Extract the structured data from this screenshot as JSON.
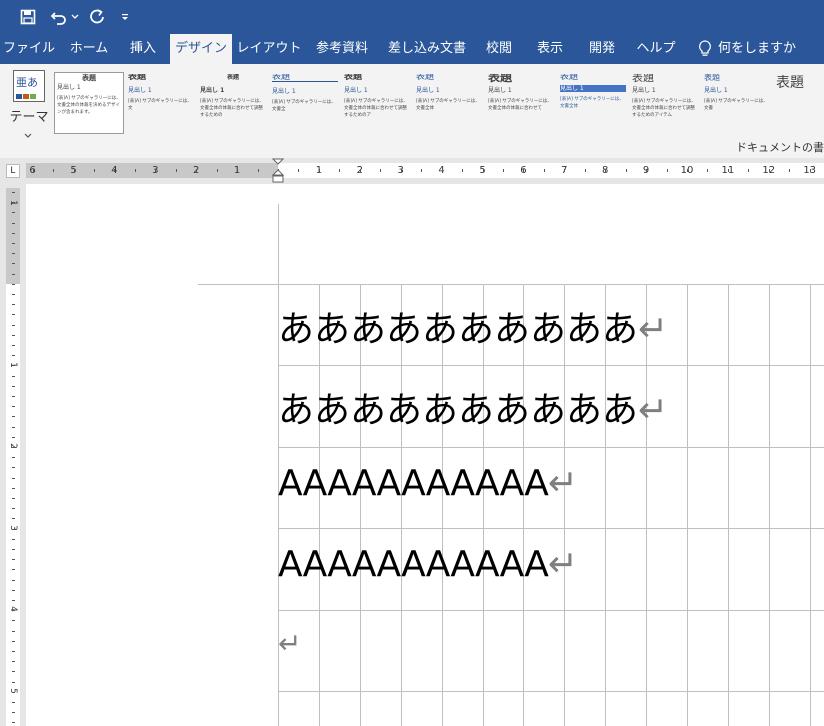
{
  "quick_access": {
    "save_icon": "save-icon",
    "undo_icon": "undo-icon",
    "undo_dropdown_icon": "chevron-down-icon",
    "redo_icon": "redo-icon",
    "customize_icon": "customize-qat-icon"
  },
  "tabs": [
    {
      "label": "ファイル"
    },
    {
      "label": "ホーム"
    },
    {
      "label": "挿入"
    },
    {
      "label": "デザイン"
    },
    {
      "label": "レイアウト"
    },
    {
      "label": "参考資料"
    },
    {
      "label": "差し込み文書"
    },
    {
      "label": "校閲"
    },
    {
      "label": "表示"
    },
    {
      "label": "開発"
    },
    {
      "label": "ヘルプ"
    }
  ],
  "tell_me": {
    "icon": "lightbulb-icon",
    "label": "何をしますか"
  },
  "ribbon": {
    "theme_button": {
      "icon_text": "亜あ",
      "label": "テーマ"
    },
    "styles": [
      {
        "title": "表題",
        "heading": "見出し 1",
        "body": "[表]A] サブのギャラリーには、文書全体の体裁を決めるデザインが含まれます。"
      },
      {
        "title": "表題",
        "heading": "見出し 1",
        "body": "[表]A] サブのギャラリーには、文"
      },
      {
        "title": "表題",
        "heading": "見出し 1",
        "body": "[表]A] サブのギャラリーには、文書全体の体裁に合わせて調整するための"
      },
      {
        "title": "表題",
        "heading": "見出し 1",
        "body": "[表]A] サブのギャラリーには、文書全"
      },
      {
        "title": "表題",
        "heading": "見出し 1",
        "body": "[表]A] サブのギャラリーには、文書全体の体裁に合わせて調整するためのア"
      },
      {
        "title": "表題",
        "heading": "見出し 1",
        "body": "[表]A] サブのギャラリーには、文書全体"
      },
      {
        "title": "表題",
        "heading": "見出し 1",
        "body": "[表]A] サブのギャラリーには、文書全体の体裁に合わせて"
      },
      {
        "title": "表題",
        "heading": "見出し 1",
        "body": "[表]A] サブのギャラリーには、文書全体"
      },
      {
        "title": "表題",
        "heading": "見出し 1",
        "body": "[表]A] サブのギャラリーには、文書全体の体裁に合わせて調整するためのアイテム"
      },
      {
        "title": "表題",
        "heading": "見出し 1",
        "body": "[表]A] サブのギャラリーには、文書"
      },
      {
        "title": "表題",
        "heading": "見出し 1",
        "body": "[表]A] サブのギャラリーには、文書全体の"
      },
      {
        "title": "表題",
        "heading": "",
        "body": ""
      }
    ],
    "group_label": "ドキュメントの書"
  },
  "ruler": {
    "horizontal_left": [
      "6",
      "5",
      "4",
      "3",
      "2",
      "1"
    ],
    "horizontal_right": [
      "1",
      "2",
      "3",
      "4",
      "5",
      "6",
      "7",
      "8",
      "9",
      "10",
      "11",
      "12",
      "13"
    ],
    "vertical": [
      "1",
      "1",
      "2",
      "3",
      "4",
      "5"
    ],
    "tab_selector": "L"
  },
  "document": {
    "lines": [
      {
        "text": "ああああああああああ",
        "mark": "↵"
      },
      {
        "text": "ああああああああああ",
        "mark": "↵"
      },
      {
        "text": "AAAAAAAAAAA",
        "mark": "↵"
      },
      {
        "text": "AAAAAAAAAAA",
        "mark": "↵"
      },
      {
        "text": "",
        "mark": "↵"
      }
    ]
  },
  "colors": {
    "title_bar": "#2b579a",
    "ribbon_bg": "#f3f3f3",
    "gridline": "#bfbfbf",
    "paragraph_mark": "#7f7f7f"
  }
}
